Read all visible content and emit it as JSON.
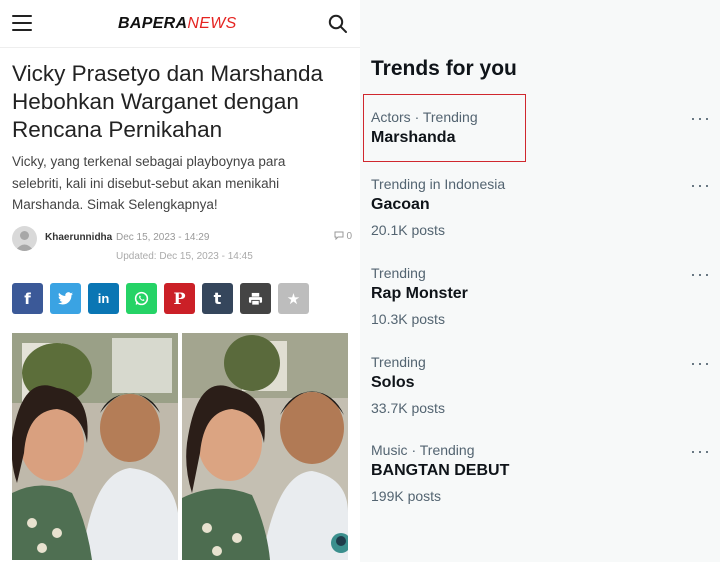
{
  "news": {
    "logo_part1": "BAPERA",
    "logo_part2": "NEWS",
    "headline": "Vicky Prasetyo dan Marshanda Hebohkan Warganet dengan Rencana Pernikahan",
    "excerpt": "Vicky, yang terkenal sebagai playboynya para selebriti, kali ini disebut-sebut akan menikahi Marshanda. Simak Selengkapnya!",
    "author": "Khaerunnidha",
    "date": "Dec 15, 2023 - 14:29",
    "comment_count": "0",
    "updated": "Updated: Dec 15, 2023 - 14:45",
    "share_buttons": [
      {
        "icon": "facebook-icon",
        "glyph": "f",
        "color": "#3b5998"
      },
      {
        "icon": "twitter-icon",
        "glyph": "🐦",
        "color": "#3aa3e3"
      },
      {
        "icon": "linkedin-icon",
        "glyph": "in",
        "color": "#0a76b4"
      },
      {
        "icon": "whatsapp-icon",
        "glyph": "✆",
        "color": "#25d366"
      },
      {
        "icon": "pinterest-icon",
        "glyph": "P",
        "color": "#cb2027"
      },
      {
        "icon": "tumblr-icon",
        "glyph": "t",
        "color": "#35465c"
      },
      {
        "icon": "print-icon",
        "glyph": "⎙",
        "color": "#444444"
      },
      {
        "icon": "star-icon",
        "glyph": "★",
        "color": "#bdbdbd"
      }
    ]
  },
  "trends": {
    "title": "Trends for you",
    "items": [
      {
        "meta": "Actors · Trending",
        "name": "Marshanda",
        "posts": ""
      },
      {
        "meta": "Trending in Indonesia",
        "name": "Gacoan",
        "posts": "20.1K posts"
      },
      {
        "meta": "Trending",
        "name": "Rap Monster",
        "posts": "10.3K posts"
      },
      {
        "meta": "Trending",
        "name": "Solos",
        "posts": "33.7K posts"
      },
      {
        "meta": "Music · Trending",
        "name": "BANGTAN DEBUT",
        "posts": "199K posts"
      }
    ],
    "more_label": "···"
  }
}
